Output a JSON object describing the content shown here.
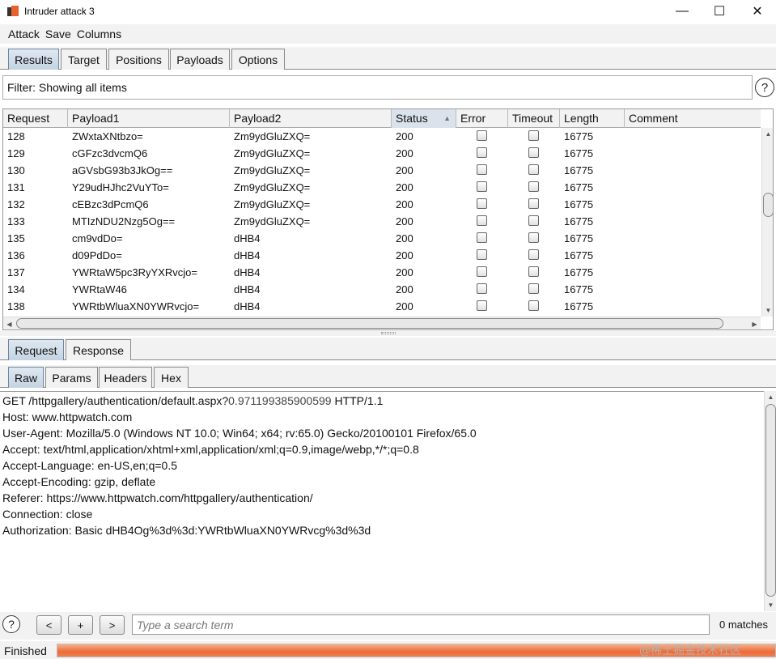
{
  "window": {
    "title": "Intruder attack 3",
    "minimize_glyph": "—",
    "maximize_glyph": "☐",
    "close_glyph": "✕"
  },
  "menu": [
    "Attack",
    "Save",
    "Columns"
  ],
  "main_tabs": [
    "Results",
    "Target",
    "Positions",
    "Payloads",
    "Options"
  ],
  "active_main_tab": "Results",
  "filter": {
    "text": "Filter: Showing all items"
  },
  "help_glyph": "?",
  "table": {
    "columns": [
      "Request",
      "Payload1",
      "Payload2",
      "Status",
      "Error",
      "Timeout",
      "Length",
      "Comment"
    ],
    "sorted_column": "Status",
    "sort_glyph": "▲",
    "rows": [
      {
        "request": "128",
        "payload1": "ZWxtaXNtbzo=",
        "payload2": "Zm9ydGluZXQ=",
        "status": "200",
        "length": "16775"
      },
      {
        "request": "129",
        "payload1": "cGFzc3dvcmQ6",
        "payload2": "Zm9ydGluZXQ=",
        "status": "200",
        "length": "16775"
      },
      {
        "request": "130",
        "payload1": "aGVsbG93b3JkOg==",
        "payload2": "Zm9ydGluZXQ=",
        "status": "200",
        "length": "16775"
      },
      {
        "request": "131",
        "payload1": "Y29udHJhc2VuYTo=",
        "payload2": "Zm9ydGluZXQ=",
        "status": "200",
        "length": "16775"
      },
      {
        "request": "132",
        "payload1": "cEBzc3dPcmQ6",
        "payload2": "Zm9ydGluZXQ=",
        "status": "200",
        "length": "16775"
      },
      {
        "request": "133",
        "payload1": "MTIzNDU2Nzg5Og==",
        "payload2": "Zm9ydGluZXQ=",
        "status": "200",
        "length": "16775"
      },
      {
        "request": "135",
        "payload1": "cm9vdDo=",
        "payload2": "dHB4",
        "status": "200",
        "length": "16775"
      },
      {
        "request": "136",
        "payload1": "d09PdDo=",
        "payload2": "dHB4",
        "status": "200",
        "length": "16775"
      },
      {
        "request": "137",
        "payload1": "YWRtaW5pc3RyYXRvcjo=",
        "payload2": "dHB4",
        "status": "200",
        "length": "16775"
      },
      {
        "request": "134",
        "payload1": "YWRtaW46",
        "payload2": "dHB4",
        "status": "200",
        "length": "16775"
      },
      {
        "request": "138",
        "payload1": "YWRtbWluaXN0YWRvcjo=",
        "payload2": "dHB4",
        "status": "200",
        "length": "16775"
      }
    ]
  },
  "detail_tabs": [
    "Request",
    "Response"
  ],
  "active_detail_tab": "Request",
  "view_tabs": [
    "Raw",
    "Params",
    "Headers",
    "Hex"
  ],
  "active_view_tab": "Raw",
  "request_text": {
    "line1_start": "GET /httpgallery/authentication/default.aspx?",
    "line1_param": "0.971199385900599",
    "line1_end": " HTTP/1.1",
    "lines": [
      "Host: www.httpwatch.com",
      "User-Agent: Mozilla/5.0 (Windows NT 10.0; Win64; x64; rv:65.0) Gecko/20100101 Firefox/65.0",
      "Accept: text/html,application/xhtml+xml,application/xml;q=0.9,image/webp,*/*;q=0.8",
      "Accept-Language: en-US,en;q=0.5",
      "Accept-Encoding: gzip, deflate",
      "Referer: https://www.httpwatch.com/httpgallery/authentication/",
      "Connection: close",
      "Authorization: Basic dHB4Og%3d%3d:YWRtbWluaXN0YWRvcg%3d%3d"
    ]
  },
  "search": {
    "prev_label": "<",
    "add_label": "+",
    "next_label": ">",
    "placeholder": "Type a search term",
    "matches": "0 matches"
  },
  "status": {
    "text": "Finished",
    "progress_fraction": 1.0,
    "progress_color": "#ec6a3a"
  },
  "watermark": "@稀土掘金技术社区"
}
